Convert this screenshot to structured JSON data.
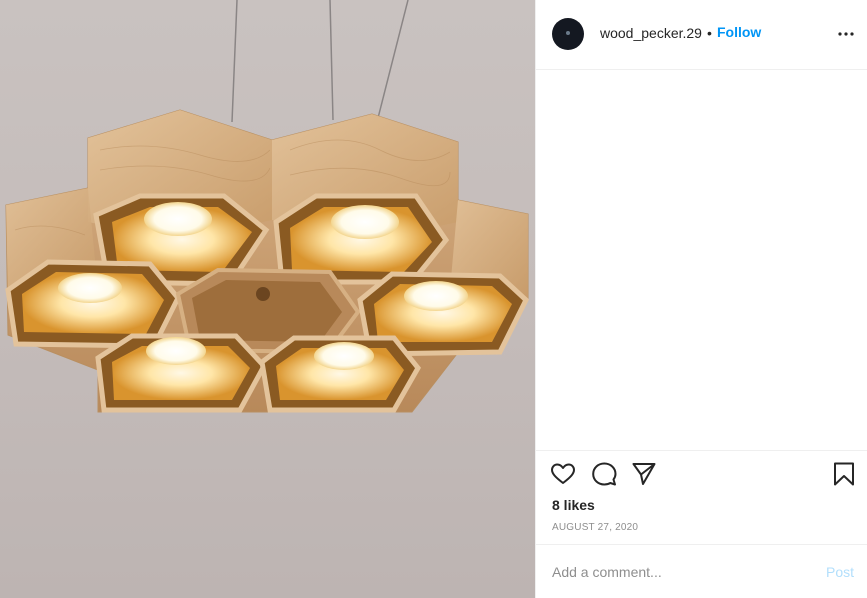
{
  "post": {
    "image_subject": "wooden hexagon honeycomb pendant lamp",
    "username": "wood_pecker.29",
    "separator": "•",
    "follow_label": "Follow",
    "likes": "8 likes",
    "date": "AUGUST 27, 2020",
    "comment_placeholder": "Add a comment...",
    "post_label": "Post"
  },
  "icons": {
    "more": "more-options-icon",
    "like": "heart-icon",
    "comment": "comment-bubble-icon",
    "share": "paper-plane-icon",
    "save": "bookmark-icon"
  },
  "colors": {
    "link": "#0095f6",
    "post_disabled": "#b2dffc",
    "text": "#262626",
    "muted": "#8e8e8e",
    "border": "#efefef"
  }
}
